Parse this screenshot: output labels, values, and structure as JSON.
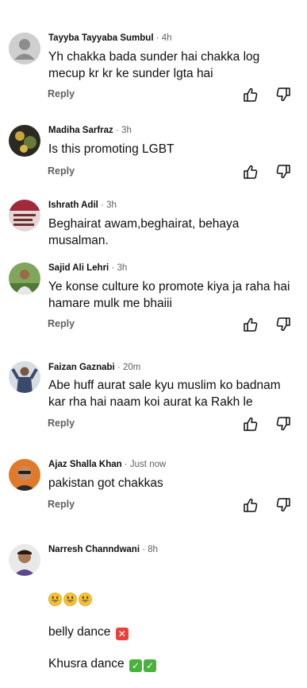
{
  "comments": [
    {
      "author": "Tayyba Tayyaba Sumbul",
      "time": "4h",
      "text": "Yh chakka bada sunder hai chakka log mecup kr kr ke sunder lgta hai",
      "reply": "Reply",
      "avatar": "default-user-avatar"
    },
    {
      "author": "Madiha Sarfraz",
      "time": "3h",
      "text": "Is this promoting LGBT",
      "reply": "Reply",
      "avatar": "photo-avatar"
    },
    {
      "author": "Ishrath Adil",
      "time": "3h",
      "text": "Beghairat awam,beghairat, behaya musalman.",
      "reply": "Reply",
      "avatar": "photo-avatar"
    },
    {
      "author": "Sajid Ali Lehri",
      "time": "3h",
      "text": "Ye konse culture ko promote kiya ja raha hai hamare mulk me bhaiii",
      "reply": "Reply",
      "avatar": "photo-avatar"
    },
    {
      "author": "Faizan Gaznabi",
      "time": "20m",
      "text": "Abe huff aurat sale kyu muslim ko badnam kar rha hai naam koi aurat ka Rakh le",
      "reply": "Reply",
      "avatar": "photo-avatar"
    },
    {
      "author": "Ajaz Shalla Khan",
      "time": "Just now",
      "text": "pakistan got chakkas",
      "reply": "Reply",
      "avatar": "photo-avatar"
    },
    {
      "author": "Narresh Channdwani",
      "time": "8h",
      "line2": " belly dance",
      "line3": "Khusra dance",
      "avatar": "photo-avatar"
    }
  ],
  "separator": " · ",
  "icons": {
    "like": "thumbs-up-icon",
    "dislike": "thumbs-down-icon",
    "smiley": "grinning-face-emoji",
    "cross": "cross-mark-emoji",
    "check": "check-mark-emoji"
  },
  "colors": {
    "text": "#0f0f0f",
    "secondary": "#606060",
    "red_badge": "#e8433b",
    "green_badge": "#49b13c"
  }
}
